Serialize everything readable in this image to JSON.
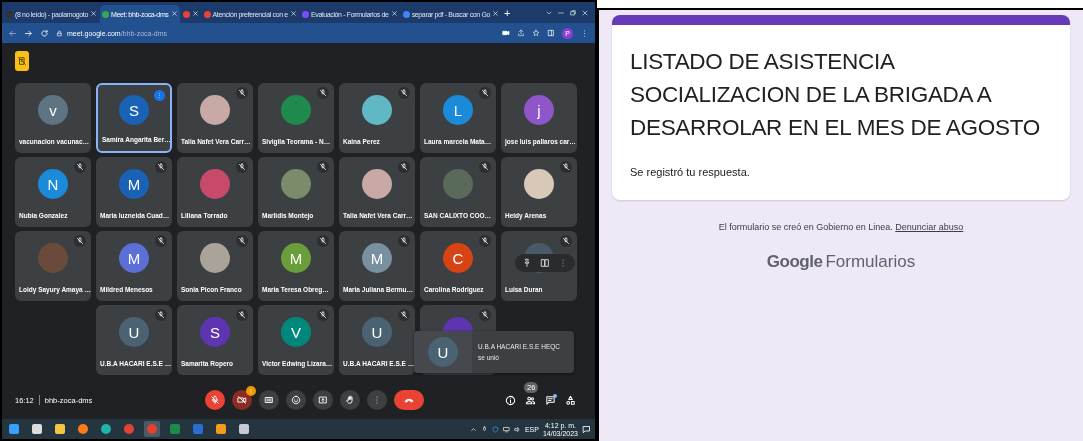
{
  "browser": {
    "tabs": [
      {
        "label": "(8 no leído) - paolamogoto",
        "selected": false
      },
      {
        "label": "Meet: bhb-zoca-dms",
        "selected": true
      },
      {
        "selected": false
      },
      {
        "label": "Atención preferencial con e",
        "selected": false
      },
      {
        "label": "Evaluación - Formularios de",
        "selected": false
      },
      {
        "label": "separar pdf - Buscar con Go",
        "selected": false
      }
    ],
    "new_tab": "+",
    "url_host": "meet.google.com",
    "url_path": "/bhb-zoca-dms",
    "profile": "P"
  },
  "meet": {
    "rows": [
      [
        {
          "name": "vacunacion vacunac…",
          "kind": "letter",
          "letter": "v",
          "color": "#5f7482",
          "muted": false,
          "speaking": false,
          "hovered": false
        },
        {
          "name": "Samira Angarita Ber…",
          "kind": "letter",
          "letter": "S",
          "color": "#1a62b5",
          "muted": false,
          "speaking": true,
          "hovered": false
        },
        {
          "name": "Talia Nafet Vera Carr…",
          "kind": "photo",
          "color": "#c9a9a6",
          "muted": true,
          "speaking": false,
          "hovered": false
        },
        {
          "name": "Sivigila Teorama - N…",
          "kind": "photo",
          "color": "#1e8a4c",
          "muted": true,
          "speaking": false,
          "hovered": false
        },
        {
          "name": "Kaina Perez",
          "kind": "photo",
          "color": "#5fb8c4",
          "muted": true,
          "speaking": false,
          "hovered": false
        },
        {
          "name": "Laura marcela Mata…",
          "kind": "letter",
          "letter": "L",
          "color": "#1b8ad8",
          "muted": true,
          "speaking": false,
          "hovered": false
        },
        {
          "name": "jose luis pallaros car…",
          "kind": "letter",
          "letter": "j",
          "color": "#8e56c9",
          "muted": false,
          "speaking": false,
          "hovered": false
        }
      ],
      [
        {
          "name": "Nubia Gonzalez",
          "kind": "letter",
          "letter": "N",
          "color": "#1b8ad8",
          "muted": true,
          "speaking": false,
          "hovered": false
        },
        {
          "name": "Maria luzneida Cuad…",
          "kind": "letter",
          "letter": "M",
          "color": "#1a62b5",
          "muted": true,
          "speaking": false,
          "hovered": false
        },
        {
          "name": "Liliana Torrado",
          "kind": "photo",
          "color": "#c84a6a",
          "muted": true,
          "speaking": false,
          "hovered": false
        },
        {
          "name": "Marlidis Montejo",
          "kind": "photo",
          "color": "#7a8c6a",
          "muted": true,
          "speaking": false,
          "hovered": false
        },
        {
          "name": "Talia Nafet Vera Carr…",
          "kind": "photo",
          "color": "#c9a9a6",
          "muted": true,
          "speaking": false,
          "hovered": false
        },
        {
          "name": "SAN CALIXTO COO…",
          "kind": "photo",
          "color": "#5a6a5a",
          "muted": true,
          "speaking": false,
          "hovered": false
        },
        {
          "name": "Heidy Arenas",
          "kind": "photo",
          "color": "#d8c8b8",
          "muted": true,
          "speaking": false,
          "hovered": false
        }
      ],
      [
        {
          "name": "Loidy Sayury Amaya …",
          "kind": "photo",
          "color": "#6a4a3a",
          "muted": true,
          "speaking": false,
          "hovered": false
        },
        {
          "name": "Mildred Menesos",
          "kind": "letter",
          "letter": "M",
          "color": "#5b6fd6",
          "muted": true,
          "speaking": false,
          "hovered": false
        },
        {
          "name": "Sonia Picon Franco",
          "kind": "photo",
          "color": "#a9a39a",
          "muted": true,
          "speaking": false,
          "hovered": false
        },
        {
          "name": "Maria Teresa Obreg…",
          "kind": "letter",
          "letter": "M",
          "color": "#6a9e3a",
          "muted": true,
          "speaking": false,
          "hovered": false
        },
        {
          "name": "Maria Juliana Bermu…",
          "kind": "letter",
          "letter": "M",
          "color": "#7890a0",
          "muted": true,
          "speaking": false,
          "hovered": false
        },
        {
          "name": "Carolina Rodriguez",
          "kind": "letter",
          "letter": "C",
          "color": "#d84315",
          "muted": true,
          "speaking": false,
          "hovered": false
        },
        {
          "name": "Luisa Duran",
          "kind": "letter",
          "color": "#4a5a6a",
          "muted": true,
          "speaking": false,
          "hovered": true
        }
      ],
      [
        "",
        {
          "name": "U.B.A HACARI E.S.E …",
          "kind": "letter",
          "letter": "U",
          "color": "#4a6272",
          "muted": true,
          "speaking": false,
          "hovered": false
        },
        {
          "name": "Samarita Ropero",
          "kind": "letter",
          "letter": "S",
          "color": "#5e35b1",
          "muted": true,
          "speaking": false,
          "hovered": false
        },
        {
          "name": "Victor Edwing Lizara…",
          "kind": "letter",
          "letter": "V",
          "color": "#00897b",
          "muted": true,
          "speaking": false,
          "hovered": false
        },
        {
          "name": "U.B.A HACARI E.S.E …",
          "kind": "letter",
          "letter": "U",
          "color": "#4a6272",
          "muted": true,
          "speaking": false,
          "hovered": false
        },
        {
          "kind": "letter",
          "color": "#5e35b1",
          "muted": true,
          "speaking": false,
          "hovered": false
        }
      ]
    ],
    "toast": {
      "letter": "U",
      "title": "U.B.A HACARI E.S.E HEQC",
      "text": "se unió"
    },
    "time": "16:12",
    "code": "bhb-zoca-dms",
    "controls": [
      {
        "kind": "mic",
        "off": true
      },
      {
        "kind": "camera",
        "off": true,
        "badge": "!"
      },
      {
        "kind": "captions",
        "off": false
      },
      {
        "kind": "reactions",
        "off": false
      },
      {
        "kind": "present",
        "off": false
      },
      {
        "kind": "hand",
        "off": false
      },
      {
        "kind": "more",
        "off": false
      },
      {
        "kind": "leave",
        "off": false
      }
    ],
    "side_buttons": [
      {
        "kind": "info"
      },
      {
        "kind": "people",
        "badge": "26"
      },
      {
        "kind": "chat",
        "dot": true
      },
      {
        "kind": "activities"
      }
    ]
  },
  "taskbar": {
    "apps": [
      {
        "kind": "start",
        "active": false
      },
      {
        "kind": "taskview",
        "active": false
      },
      {
        "kind": "folder",
        "active": false
      },
      {
        "kind": "firefox",
        "active": false
      },
      {
        "kind": "edge",
        "active": false
      },
      {
        "kind": "chrome",
        "active": false
      },
      {
        "kind": "chrome",
        "active": true
      },
      {
        "kind": "excel",
        "active": false
      },
      {
        "kind": "word",
        "active": false
      },
      {
        "kind": "notes",
        "active": false
      },
      {
        "kind": "paint",
        "active": false
      }
    ],
    "language": "ESP",
    "time": "4:12 p. m.",
    "date": "14/03/2023"
  },
  "form": {
    "title": "LISTADO DE ASISTENCIA SOCIALIZACION DE LA BRIGADA A DESARROLAR EN EL MES DE AGOSTO",
    "message": "Se registró tu respuesta.",
    "footer": "El formulario se creó en Gobierno en Linea.",
    "abuse_link": "Denunciar abuso",
    "logo_brand": "Google",
    "logo_product": "Formularios"
  }
}
